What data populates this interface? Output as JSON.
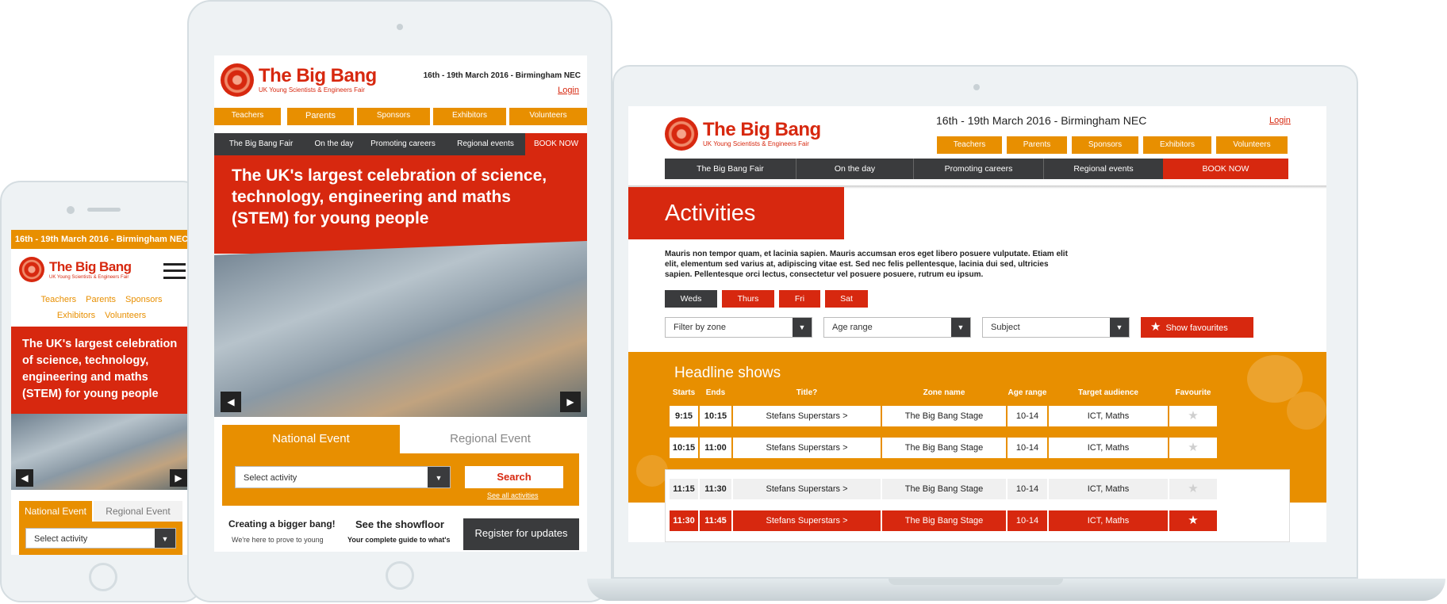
{
  "brand": {
    "name": "The Big Bang",
    "tagline": "UK Young Scientists & Engineers Fair"
  },
  "event_date": "16th - 19th March 2016 - Birmingham NEC",
  "login": "Login",
  "nav_orange": [
    "Teachers",
    "Parents",
    "Sponsors",
    "Exhibitors",
    "Volunteers"
  ],
  "nav_dark": [
    "The Big Bang Fair",
    "On the day",
    "Promoting careers",
    "Regional events"
  ],
  "book_now": "BOOK NOW",
  "hero_text": "The UK's largest celebration of science, technology, engineering and maths (STEM) for young people",
  "tabs": {
    "national": "National Event",
    "regional": "Regional Event"
  },
  "select_activity": "Select activity",
  "search": "Search",
  "see_all": "See all activities",
  "promo": {
    "bigger_title": "Creating a bigger bang!",
    "bigger_text": "We're here to prove to young",
    "showfloor_title": "See the showfloor",
    "showfloor_text": "Your complete guide to what's",
    "register": "Register for updates"
  },
  "arrows": {
    "prev": "◀",
    "next": "▶"
  },
  "activities": {
    "title": "Activities",
    "intro": "Mauris non tempor quam, et lacinia sapien. Mauris accumsan eros eget libero posuere vulputate. Etiam elit elit, elementum sed varius at, adipiscing vitae est. Sed nec felis pellentesque, lacinia dui sed, ultricies sapien. Pellentesque orci lectus, consectetur vel posuere posuere, rutrum eu ipsum.",
    "days": [
      "Weds",
      "Thurs",
      "Fri",
      "Sat"
    ],
    "filters": [
      "Filter by zone",
      "Age range",
      "Subject"
    ],
    "show_favourites": "Show favourites",
    "headline": "Headline shows",
    "columns": [
      "Starts",
      "Ends",
      "Title?",
      "Zone name",
      "Age range",
      "Target audience",
      "Favourite"
    ],
    "rows": [
      [
        "9:15",
        "10:15",
        "Stefans Superstars >",
        "The Big Bang Stage",
        "10-14",
        "ICT, Maths"
      ],
      [
        "10:15",
        "11:00",
        "Stefans Superstars >",
        "The Big Bang Stage",
        "10-14",
        "ICT, Maths"
      ],
      [
        "11:15",
        "11:30",
        "Stefans Superstars >",
        "The Big Bang Stage",
        "10-14",
        "ICT, Maths"
      ],
      [
        "11:30",
        "11:45",
        "Stefans Superstars >",
        "The Big Bang Stage",
        "10-14",
        "ICT, Maths"
      ]
    ]
  },
  "colors": {
    "orange": "#e88f00",
    "red": "#d7280f",
    "dark": "#3a3b3d"
  }
}
